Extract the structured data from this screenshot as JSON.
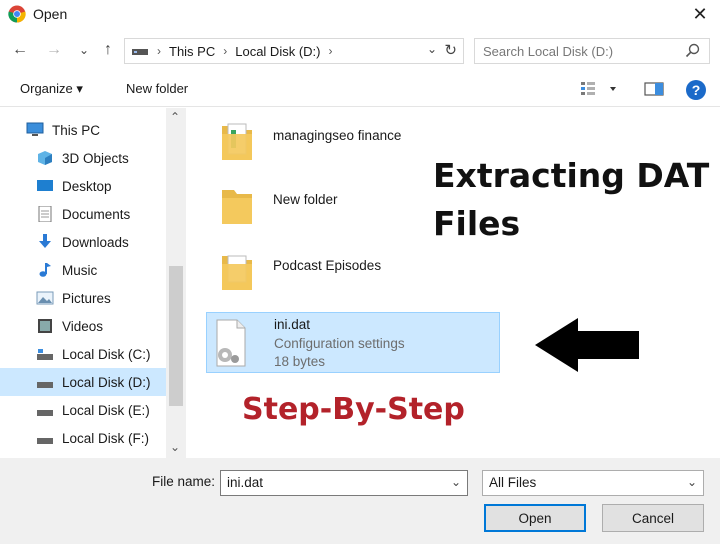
{
  "window": {
    "title": "Open",
    "app_icon": "chrome-icon",
    "close_glyph": "✕"
  },
  "nav_buttons": {
    "back": "←",
    "forward": "→",
    "recent": "⌄",
    "up": "↑"
  },
  "address": {
    "crumbs": [
      "This PC",
      "Local Disk (D:)"
    ],
    "separator": "›",
    "dropdown": "⌄",
    "refresh": "↻"
  },
  "search": {
    "placeholder": "Search Local Disk (D:)",
    "icon": "search-icon"
  },
  "toolbar": {
    "organize": "Organize ▾",
    "new_folder": "New folder",
    "view_icon": "view-options-icon",
    "preview_icon": "preview-pane-icon",
    "help": "?"
  },
  "sidebar": {
    "items": [
      {
        "label": "This PC",
        "icon": "computer-icon"
      },
      {
        "label": "3D Objects",
        "icon": "cube-icon"
      },
      {
        "label": "Desktop",
        "icon": "desktop-icon"
      },
      {
        "label": "Documents",
        "icon": "document-icon"
      },
      {
        "label": "Downloads",
        "icon": "download-icon"
      },
      {
        "label": "Music",
        "icon": "music-icon"
      },
      {
        "label": "Pictures",
        "icon": "pictures-icon"
      },
      {
        "label": "Videos",
        "icon": "video-icon"
      },
      {
        "label": "Local Disk (C:)",
        "icon": "drive-icon"
      },
      {
        "label": "Local Disk (D:)",
        "icon": "drive-icon",
        "selected": true
      },
      {
        "label": "Local Disk (E:)",
        "icon": "drive-icon"
      },
      {
        "label": "Local Disk (F:)",
        "icon": "drive-icon"
      }
    ],
    "scroll_up": "⌃",
    "scroll_down": "⌄"
  },
  "files": [
    {
      "name": "managingseo finance",
      "type": "folder"
    },
    {
      "name": "New folder",
      "type": "folder"
    },
    {
      "name": "Podcast Episodes",
      "type": "folder"
    },
    {
      "name": "ini.dat",
      "type": "file",
      "description": "Configuration settings",
      "size": "18 bytes",
      "selected": true
    }
  ],
  "overlay": {
    "title_line1": "Extracting DAT",
    "title_line2": "Files",
    "step": "Step-By-Step",
    "step_color": "#b3222a"
  },
  "footer": {
    "file_name_label": "File name:",
    "file_name_value": "ini.dat",
    "file_type": "All Files",
    "open_label": "Open",
    "cancel_label": "Cancel"
  },
  "colors": {
    "selection": "#cce8ff",
    "accent": "#0078d7",
    "folder": "#f4c95d"
  }
}
